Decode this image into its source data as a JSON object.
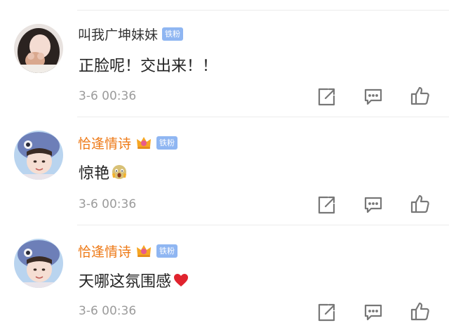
{
  "comments": [
    {
      "user": "叫我广坤妹妹",
      "badge": "铁粉",
      "text": "正脸呢！交出来！！",
      "time": "3-6 00:36"
    },
    {
      "user": "恰逢情诗",
      "badge": "铁粉",
      "text": "惊艳",
      "emoji": "scream-emoji",
      "time": "3-6 00:36"
    },
    {
      "user": "恰逢情诗",
      "badge": "铁粉",
      "text": "天哪这氛围感",
      "emoji": "red-heart-emoji",
      "time": "3-6 00:36"
    }
  ],
  "icons": [
    "share-icon",
    "comment-icon",
    "like-icon",
    "crown-icon"
  ],
  "colors": {
    "vip_name": "#ee7a17",
    "badge_bg": "#8fb6f2",
    "time_gray": "#9b9b9b",
    "icon_gray": "#777777",
    "heart": "#e0232e"
  }
}
